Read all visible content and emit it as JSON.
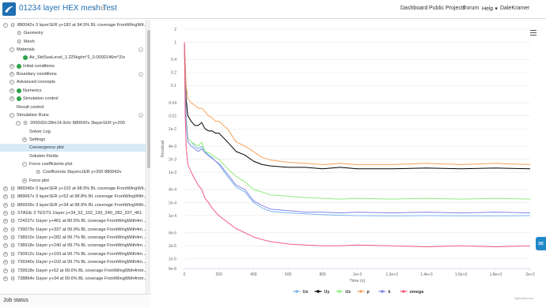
{
  "header": {
    "project_title": "01234 layer HEX mesh Test",
    "nav": [
      "Dashboard",
      "Public Projects",
      "Forum",
      "Help ▾",
      "DaleKramer"
    ]
  },
  "tree": [
    {
      "level": 0,
      "toggle": "-",
      "icon": "gear",
      "label": "880042v 3 layer1ER y+182 at 94.5% BL coverage FrontWingWit..."
    },
    {
      "level": 1,
      "toggle": "",
      "icon": "gear",
      "label": "Geometry"
    },
    {
      "level": 1,
      "toggle": "",
      "icon": "gear",
      "label": "Mesh"
    },
    {
      "level": 1,
      "toggle": "-",
      "icon": "",
      "label": "Materials",
      "menu": true
    },
    {
      "level": 2,
      "toggle": "",
      "icon": "check",
      "label": "Air_StdSeaLevel_1.225kg/m^2_0.0000146m^2/s"
    },
    {
      "level": 1,
      "toggle": "+",
      "icon": "check",
      "label": "Initial conditions"
    },
    {
      "level": 1,
      "toggle": "+",
      "icon": "",
      "label": "Boundary conditions",
      "menu": true
    },
    {
      "level": 1,
      "toggle": "-",
      "icon": "",
      "label": "Advanced concepts"
    },
    {
      "level": 1,
      "toggle": "+",
      "icon": "check",
      "label": "Numerics"
    },
    {
      "level": 1,
      "toggle": "+",
      "icon": "check",
      "label": "Simulation control"
    },
    {
      "level": 1,
      "toggle": "",
      "icon": "",
      "label": "Result control"
    },
    {
      "level": 1,
      "toggle": "-",
      "icon": "",
      "label": "Simulation Runs",
      "menu": true
    },
    {
      "level": 2,
      "toggle": "-",
      "icon": "gear",
      "label": "2000i32c28m14.9chr 880042v 3layer1ER y+200"
    },
    {
      "level": 3,
      "toggle": "",
      "icon": "",
      "label": "Solver Log"
    },
    {
      "level": 3,
      "toggle": "+",
      "icon": "",
      "label": "Settings"
    },
    {
      "level": 3,
      "toggle": "",
      "icon": "",
      "label": "Convergence plot",
      "selected": true
    },
    {
      "level": 3,
      "toggle": "",
      "icon": "",
      "label": "Solution Fields"
    },
    {
      "level": 3,
      "toggle": "-",
      "icon": "",
      "label": "Force coefficients plot"
    },
    {
      "level": 4,
      "toggle": "",
      "icon": "gear",
      "label": "Coefficients 3layers1ER y+200 880042v"
    },
    {
      "level": 3,
      "toggle": "+",
      "icon": "",
      "label": "Force plot"
    },
    {
      "level": 0,
      "toggle": "+",
      "icon": "gear",
      "label": "889340v 3 layer1ER y+102 at 98.5% BL coverage FrontWingWit..."
    },
    {
      "level": 0,
      "toggle": "+",
      "icon": "gear",
      "label": "889667v 3 layer1ER y+52 at 98.8% BL coverage FrontWingWith..."
    },
    {
      "level": 0,
      "toggle": "+",
      "icon": "gear",
      "label": "889939v 3 layer1ER y+34 at 98.9% BL coverage FrontWingWith..."
    },
    {
      "level": 0,
      "toggle": "+",
      "icon": "gear",
      "label": "STAGE 3 TESTS 1layer y+34_52_102_193_240_282_337_461"
    },
    {
      "level": 0,
      "toggle": "+",
      "icon": "gear",
      "label": "724227v 1layer y+461 at 80.5% BL coverage FrontWingWith4m..."
    },
    {
      "level": 0,
      "toggle": "+",
      "icon": "gear",
      "label": "739073v 1layer y+337 at 99.9% BL coverage FrontWingWith4m..."
    },
    {
      "level": 0,
      "toggle": "+",
      "icon": "gear",
      "label": "738910v 1layer y+282 at 99.7% BL coverage FrontWingWith4m..."
    },
    {
      "level": 0,
      "toggle": "+",
      "icon": "gear",
      "label": "738918v 1layer y+240 at 99.7% BL coverage FrontWingWith4m..."
    },
    {
      "level": 0,
      "toggle": "+",
      "icon": "gear",
      "label": "730912v 1layer y+193 at 99.7% BL coverage FrontWingWith4m..."
    },
    {
      "level": 0,
      "toggle": "+",
      "icon": "gear",
      "label": "739340v 1layer y+102 at 99.7% BL coverage FrontWingWith4m..."
    },
    {
      "level": 0,
      "toggle": "+",
      "icon": "gear",
      "label": "739918v 1layer y+52 at 99.6% BL coverage FrontWingWith4mm..."
    },
    {
      "level": 0,
      "toggle": "+",
      "icon": "gear",
      "label": "738864v 1layer y+34 at 99.6% BL coverage FrontWingWith4mm..."
    }
  ],
  "job_status": "Job status",
  "credit": "Highcharts.com",
  "chart_data": {
    "type": "line",
    "ylabel": "Residual",
    "xlabel": "Time (s)",
    "xlim": [
      0,
      2000
    ],
    "ylim": [
      6e-06,
      2
    ],
    "yscale": "log",
    "y_ticks": [
      2,
      1,
      0.4,
      0.2,
      0.1,
      0.04,
      0.02,
      0.01,
      0.004,
      0.002,
      0.001,
      0.0004,
      0.0002,
      0.0001,
      4e-05,
      2e-05,
      1e-05,
      6e-06
    ],
    "y_tick_labels": [
      "2",
      "1",
      "0.4",
      "0.2",
      "0.1",
      "0.04",
      "0.02",
      "1e-2",
      "4e-3",
      "2e-3",
      "1e-3",
      "4e-4",
      "2e-4",
      "1e-4",
      "4e-5",
      "2e-5",
      "1e-5",
      "6e-6"
    ],
    "x_ticks": [
      0,
      200,
      400,
      600,
      800,
      1000,
      1200,
      1400,
      1600,
      1800,
      2000
    ],
    "x_tick_labels": [
      "0",
      "200",
      "400",
      "600",
      "800",
      "1e+3",
      "1.2e+3",
      "1.4e+3",
      "1.6e+3",
      "1.8e+3",
      "2e+3"
    ],
    "grid": "horizontal",
    "legend": "bottom-center",
    "x": [
      0,
      5,
      10,
      20,
      40,
      60,
      80,
      100,
      120,
      140,
      160,
      180,
      200,
      250,
      300,
      350,
      400,
      450,
      500,
      600,
      700,
      800,
      900,
      1000,
      1200,
      1400,
      1600,
      1800,
      2000
    ],
    "series": [
      {
        "name": "Ux",
        "color": "#7cb5ec",
        "values": [
          1,
          0.15,
          0.02,
          0.006,
          0.005,
          0.004,
          0.0035,
          0.004,
          0.003,
          0.0025,
          0.0022,
          0.0018,
          0.0015,
          0.0008,
          0.00045,
          0.00035,
          0.0002,
          0.00015,
          0.000125,
          0.000115,
          0.00011,
          0.000105,
          0.000102,
          0.0001,
          9.8e-05,
          0.0001,
          9.9e-05,
          9.8e-05,
          0.0001
        ]
      },
      {
        "name": "Uy",
        "color": "#000000",
        "values": [
          1,
          0.2,
          0.05,
          0.02,
          0.015,
          0.012,
          0.012,
          0.014,
          0.01,
          0.009,
          0.009,
          0.008,
          0.008,
          0.005,
          0.003,
          0.0025,
          0.0018,
          0.0015,
          0.0014,
          0.0013,
          0.0013,
          0.0012,
          0.0013,
          0.0012,
          0.0012,
          0.00125,
          0.0012,
          0.00125,
          0.0012
        ]
      },
      {
        "name": "Uz",
        "color": "#90ed7d",
        "values": [
          1,
          0.12,
          0.02,
          0.006,
          0.005,
          0.0045,
          0.004,
          0.005,
          0.003,
          0.0028,
          0.0025,
          0.0022,
          0.002,
          0.0012,
          0.0008,
          0.0006,
          0.0004,
          0.00035,
          0.0003,
          0.00028,
          0.00026,
          0.00025,
          0.00024,
          0.00025,
          0.00024,
          0.00025,
          0.00024,
          0.00025,
          0.00024
        ]
      },
      {
        "name": "p",
        "color": "#f7a35c",
        "values": [
          1,
          0.4,
          0.1,
          0.05,
          0.04,
          0.035,
          0.03,
          0.03,
          0.025,
          0.02,
          0.018,
          0.015,
          0.015,
          0.01,
          0.005,
          0.004,
          0.003,
          0.0022,
          0.0019,
          0.0017,
          0.0016,
          0.0015,
          0.0016,
          0.0015,
          0.0015,
          0.0016,
          0.0015,
          0.0016,
          0.0015
        ]
      },
      {
        "name": "k",
        "color": "#8085e9",
        "values": [
          1,
          0.1,
          0.015,
          0.005,
          0.004,
          0.0035,
          0.003,
          0.0035,
          0.0028,
          0.0024,
          0.0021,
          0.0018,
          0.0016,
          0.0009,
          0.0005,
          0.0004,
          0.00022,
          0.00017,
          0.00014,
          0.00013,
          0.00012,
          0.00012,
          0.000115,
          0.00012,
          0.000115,
          0.00012,
          0.000115,
          0.00012,
          0.000115
        ]
      },
      {
        "name": "omega",
        "color": "#f15c80",
        "values": [
          1,
          0.02,
          0.004,
          0.0015,
          0.001,
          0.0007,
          0.0005,
          0.0004,
          0.00025,
          0.0002,
          0.00015,
          0.00012,
          0.0001,
          7e-05,
          5e-05,
          4e-05,
          3.2e-05,
          2.8e-05,
          2.5e-05,
          2.2e-05,
          2.1e-05,
          2e-05,
          2e-05,
          2.1e-05,
          2e-05,
          1.9e-05,
          2e-05,
          1.9e-05,
          2e-05
        ]
      }
    ]
  }
}
